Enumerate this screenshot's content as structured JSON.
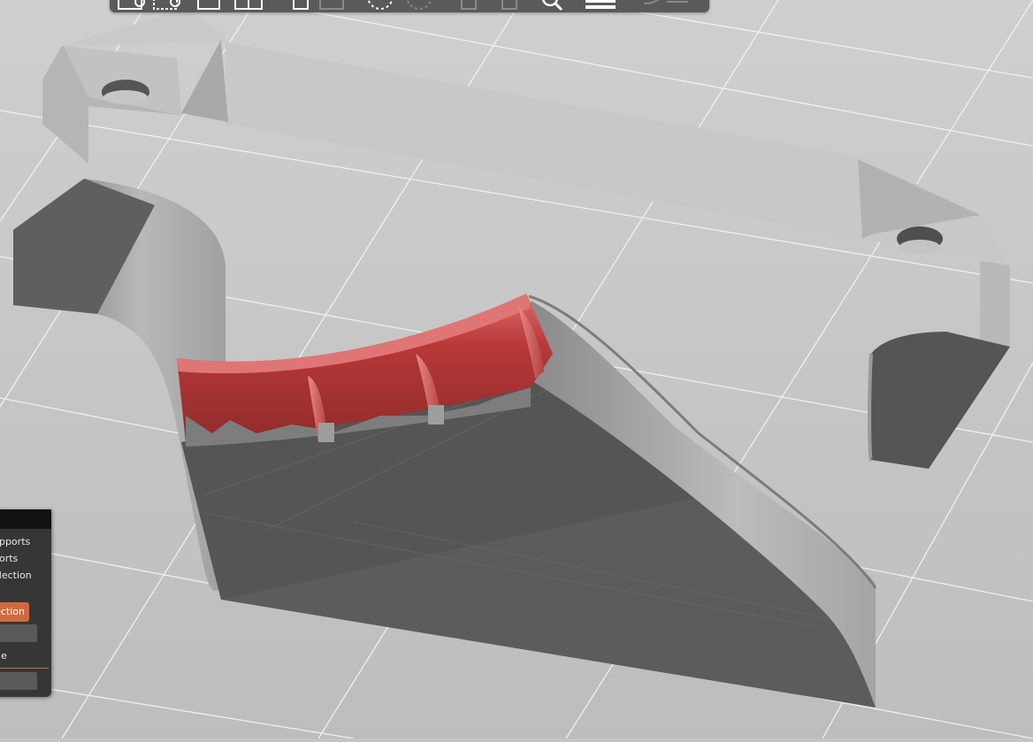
{
  "window": {
    "title": ""
  },
  "toolbar": {
    "buttons": [
      {
        "icon": "add-object-icon"
      },
      {
        "icon": "delete-object-icon"
      },
      {
        "icon": "arrange-icon"
      },
      {
        "icon": "split-icon"
      },
      {
        "icon": "copy-icon"
      },
      {
        "icon": "paste-icon"
      },
      {
        "icon": "add-instance-icon"
      },
      {
        "icon": "remove-instance-icon"
      },
      {
        "icon": "split-objects-icon"
      },
      {
        "icon": "split-parts-icon"
      },
      {
        "icon": "search-icon"
      },
      {
        "icon": "layers-editing-icon"
      },
      {
        "icon": "undo-redo-icon"
      }
    ]
  },
  "support_panel": {
    "items": [
      {
        "label": "upports"
      },
      {
        "label": "ports"
      },
      {
        "label": "election"
      }
    ],
    "button_label": "ection",
    "field_label": "cle"
  },
  "viewport": {
    "background": "#c4c4c4",
    "model_color": "#9c9c9c",
    "highlight_color": "#d9494a"
  }
}
